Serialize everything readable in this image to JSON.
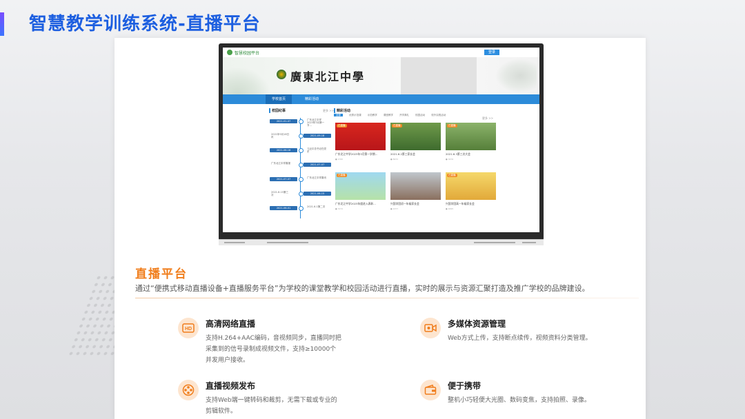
{
  "slide": {
    "title": "智慧教学训练系统-直播平台"
  },
  "screen_site": {
    "logo_text": "智慧校园平台",
    "login_label": "登录",
    "school_name": "廣東北江中學",
    "nav_tabs": [
      "学校首页",
      "精彩活动"
    ],
    "timeline": {
      "title": "校园纪事",
      "more": "更多 >>",
      "entries": [
        {
          "date": "2021-01-07",
          "text": "广东北江中学2023年3月第一节..."
        },
        {
          "date": "2021-09-18",
          "text": "2021年9月18日讯"
        },
        {
          "date": "2021-06-16",
          "text": "习近平总书记在党史"
        },
        {
          "date": "2021-07-07",
          "text": "广东北江中学喜报"
        },
        {
          "date": "2021-07-07",
          "text": "广东北江中学喜讯"
        },
        {
          "date": "2021-06-15",
          "text": "2021-6.15第三次"
        },
        {
          "date": "2021-06-01",
          "text": "2021-6.1第二次"
        }
      ]
    },
    "activities": {
      "title": "精彩活动",
      "more": "更多 >>",
      "filters": [
        "全部",
        "优秀示范课",
        "示范教学",
        "课堂教学",
        "开学典礼",
        "校园活动",
        "校外实践活动"
      ],
      "items": [
        {
          "tag": "已直播",
          "caption": "广东北江中学2023年3月第一学期...",
          "views": "● 1795"
        },
        {
          "tag": "已直播",
          "caption": "2021.6.2第三家长会",
          "views": "● 8972"
        },
        {
          "tag": "已直播",
          "caption": "2021.6.3第三次大会",
          "views": "● 3476"
        },
        {
          "tag": "已直播",
          "caption": "广东北江中学2023年度进入表彰...",
          "views": "● 3172"
        },
        {
          "tag": "",
          "caption": "兴国学团初一年级家长会",
          "views": "● 4377"
        },
        {
          "tag": "已直播",
          "caption": "兴国学团高一年级家长会",
          "views": "● 4695"
        }
      ]
    }
  },
  "section": {
    "title": "直播平台",
    "description": "通过“便携式移动直播设备+直播服务平台”为学校的课堂教学和校园活动进行直播，实时的展示与资源汇聚打造及推广学校的品牌建设。"
  },
  "features": [
    {
      "icon": "hd-icon",
      "title": "高清网络直播",
      "desc_lines": [
        "支持H.264+AAC编码，音视频同步，直播同时把",
        "采集到的信号录制成视频文件，支持≥10000个",
        "并发用户接收。"
      ]
    },
    {
      "icon": "video-camera-icon",
      "title": "多媒体资源管理",
      "desc_lines": [
        "Web方式上传，支持断点续传，视频资料分类管理。"
      ]
    },
    {
      "icon": "film-reel-icon",
      "title": "直播视频发布",
      "desc_lines": [
        "支持Web端一键转码和裁剪，无需下载或专业的",
        "剪辑软件。"
      ]
    },
    {
      "icon": "wallet-icon",
      "title": "便于携带",
      "desc_lines": [
        "整机小巧轻便大光圈、数码变焦，支持拍照、录像。"
      ]
    }
  ],
  "colors": {
    "title_blue": "#1d5fe0",
    "orange": "#f07d1b",
    "icon_bg": "#fde5cf",
    "site_blue": "#2c8bd9"
  }
}
